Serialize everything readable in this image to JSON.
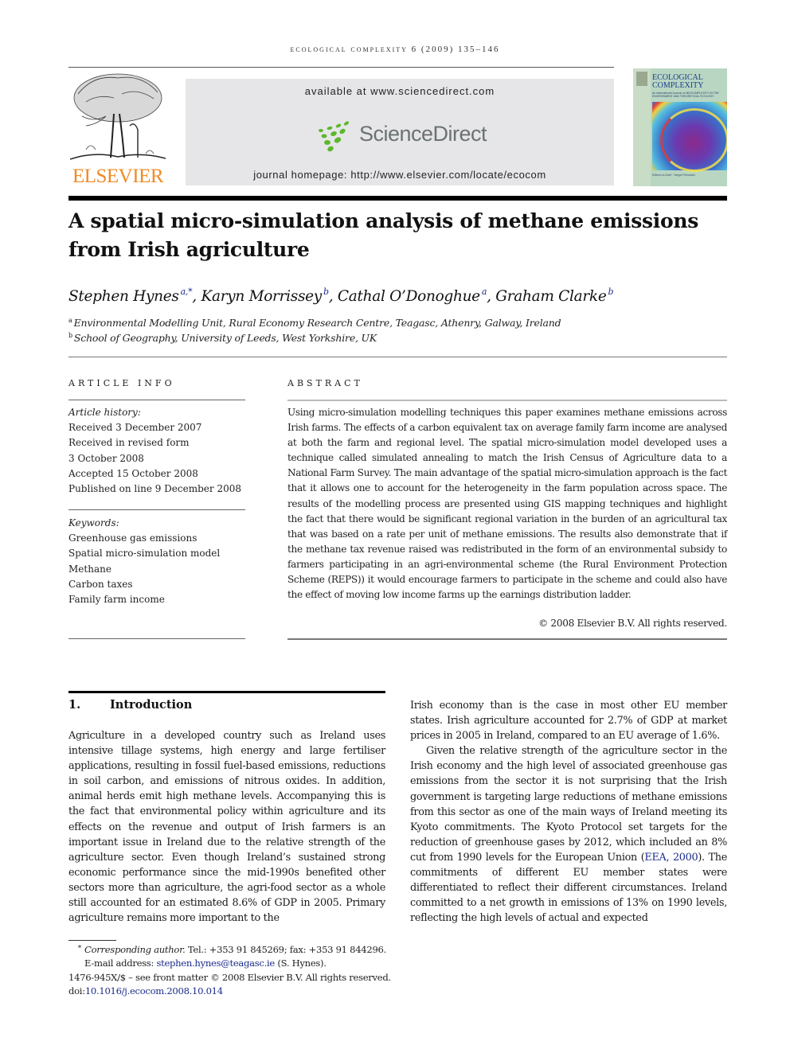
{
  "running_header": "ecological complexity 6 (2009) 135–146",
  "publisher": {
    "name": "ELSEVIER",
    "brand_color": "#f08a24"
  },
  "banner": {
    "available_text": "available at www.sciencedirect.com",
    "logo_text": "ScienceDirect",
    "logo_color": "#6b7272",
    "logo_dots_color": "#5cb82e",
    "homepage_text": "journal homepage: http://www.elsevier.com/locate/ecocom"
  },
  "cover": {
    "title_line1": "ECOLOGICAL",
    "title_line2": "COMPLEXITY",
    "subtitle": "An International Journal on BIOCOMPLEXITY IN THE ENVIRONMENT AND THEORETICAL ECOLOGY",
    "editors": "Editors-in-Chief · Sergei Petrovskii"
  },
  "article": {
    "title": "A spatial micro-simulation analysis of methane emissions from Irish agriculture",
    "authors": [
      {
        "name": "Stephen Hynes",
        "sup": "a,*"
      },
      {
        "name": "Karyn Morrissey",
        "sup": "b"
      },
      {
        "name": "Cathal O’Donoghue",
        "sup": "a"
      },
      {
        "name": "Graham Clarke",
        "sup": "b"
      }
    ],
    "affiliations": [
      {
        "key": "a",
        "text": "Environmental Modelling Unit, Rural Economy Research Centre, Teagasc, Athenry, Galway, Ireland"
      },
      {
        "key": "b",
        "text": "School of Geography, University of Leeds, West Yorkshire, UK"
      }
    ]
  },
  "article_info": {
    "heading": "ARTICLE INFO",
    "history_label": "Article history:",
    "history": [
      "Received 3 December 2007",
      "Received in revised form",
      "3 October 2008",
      "Accepted 15 October 2008",
      "Published on line 9 December 2008"
    ],
    "keywords_label": "Keywords:",
    "keywords": [
      "Greenhouse gas emissions",
      "Spatial micro-simulation model",
      "Methane",
      "Carbon taxes",
      "Family farm income"
    ]
  },
  "abstract": {
    "heading": "ABSTRACT",
    "text": "Using micro-simulation modelling techniques this paper examines methane emissions across Irish farms. The effects of a carbon equivalent tax on average family farm income are analysed at both the farm and regional level. The spatial micro-simulation model developed uses a technique called simulated annealing to match the Irish Census of Agriculture data to a National Farm Survey. The main advantage of the spatial micro-simulation approach is the fact that it allows one to account for the heterogeneity in the farm population across space. The results of the modelling process are presented using GIS mapping techniques and highlight the fact that there would be significant regional variation in the burden of an agricultural tax that was based on a rate per unit of methane emissions. The results also demonstrate that if the methane tax revenue raised was redistributed in the form of an environmental subsidy to farmers participating in an agri-environmental scheme (the Rural Environment Protection Scheme (REPS)) it would encourage farmers to participate in the scheme and could also have the effect of moving low income farms up the earnings distribution ladder.",
    "copyright": "© 2008 Elsevier B.V. All rights reserved."
  },
  "section1": {
    "number": "1.",
    "title": "Introduction",
    "left_paragraph": "Agriculture in a developed country such as Ireland uses intensive tillage systems, high energy and large fertiliser applications, resulting in fossil fuel-based emissions, reductions in soil carbon, and emissions of nitrous oxides. In addition, animal herds emit high methane levels. Accompanying this is the fact that environmental policy within agriculture and its effects on the revenue and output of Irish farmers is an important issue in Ireland due to the relative strength of the agriculture sector. Even though Ireland’s sustained strong economic performance since the mid-1990s benefited other sectors more than agriculture, the agri-food sector as a whole still accounted for an estimated 8.6% of GDP in 2005. Primary agriculture remains more important to the",
    "right_paragraph_1": "Irish economy than is the case in most other EU member states. Irish agriculture accounted for 2.7% of GDP at market prices in 2005 in Ireland, compared to an EU average of 1.6%.",
    "right_paragraph_2_before_cite": "Given the relative strength of the agriculture sector in the Irish economy and the high level of associated greenhouse gas emissions from the sector it is not surprising that the Irish government is targeting large reductions of methane emissions from this sector as one of the main ways of Ireland meeting its Kyoto commitments. The Kyoto Protocol set targets for the reduction of greenhouse gases by 2012, which included an 8% cut from 1990 levels for the European Union (",
    "citation": "EEA, 2000",
    "right_paragraph_2_after_cite": "). The commitments of different EU member states were differentiated to reflect their different circumstances. Ireland committed to a net growth in emissions of 13% on 1990 levels, reflecting the high levels of actual and expected"
  },
  "footnotes": {
    "star": "*",
    "corresponding_label": "Corresponding author.",
    "corresponding_contact": " Tel.: +353 91 845269; fax: +353 91 844296.",
    "email_label": "E-mail address: ",
    "email": "stephen.hynes@teagasc.ie",
    "email_suffix": " (S. Hynes).",
    "issn_line": "1476-945X/$ – see front matter © 2008 Elsevier B.V. All rights reserved.",
    "doi_label": "doi:",
    "doi": "10.1016/j.ecocom.2008.10.014",
    "link_color": "#1a2a8a"
  }
}
